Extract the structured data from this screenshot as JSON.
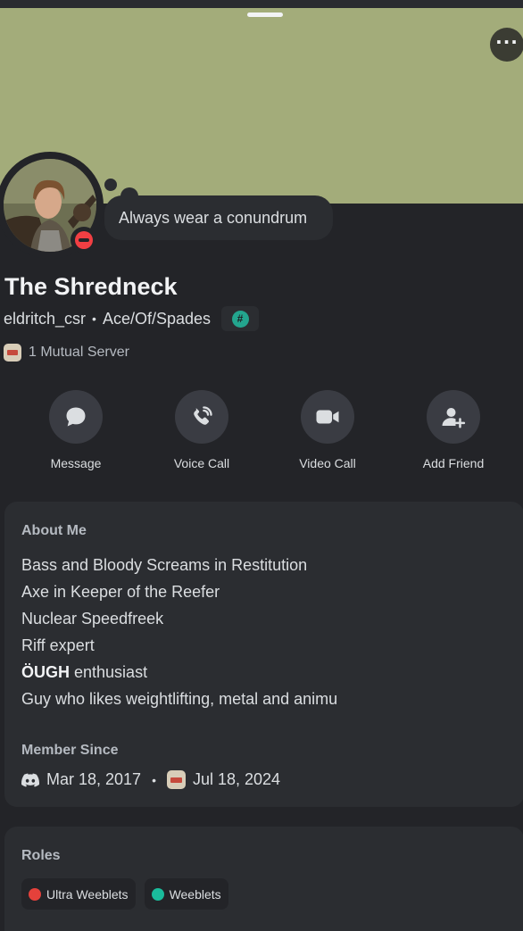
{
  "profile": {
    "custom_status": "Always wear a conundrum",
    "display_name": "The Shredneck",
    "username": "eldritch_csr",
    "pronouns": "Ace/Of/Spades",
    "tag_symbol": "#",
    "status": "do-not-disturb",
    "mutual_servers": "1 Mutual Server"
  },
  "actions": [
    {
      "label": "Message",
      "icon": "chat-bubble-icon"
    },
    {
      "label": "Voice Call",
      "icon": "phone-call-icon"
    },
    {
      "label": "Video Call",
      "icon": "video-camera-icon"
    },
    {
      "label": "Add Friend",
      "icon": "add-friend-icon"
    }
  ],
  "about": {
    "title": "About Me",
    "lines": [
      "Bass and Bloody Screams in Restitution",
      "Axe in Keeper of the Reefer",
      "Nuclear Speedfreek",
      "Riff expert"
    ],
    "bold_word": "ÖUGH",
    "bold_line_rest": "enthusiast",
    "last_line": "Guy who likes weightlifting, metal and animu",
    "member_since_title": "Member Since",
    "discord_since": "Mar 18, 2017",
    "server_since": "Jul 18, 2024"
  },
  "roles": {
    "title": "Roles",
    "items": [
      {
        "name": "Ultra Weeblets",
        "color": "#e5413b"
      },
      {
        "name": "Weeblets",
        "color": "#1abc9c"
      }
    ]
  },
  "colors": {
    "banner": "#a3ac7a",
    "background": "#232428",
    "card": "#2b2d31",
    "dnd": "#f23f43"
  }
}
